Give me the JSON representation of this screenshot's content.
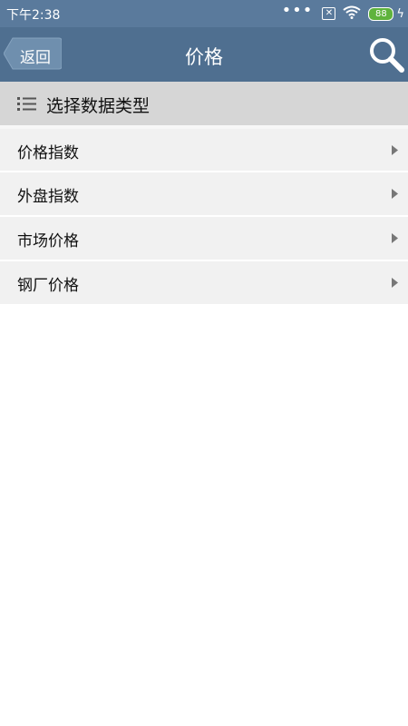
{
  "status": {
    "time": "下午2:38",
    "battery": "88"
  },
  "header": {
    "back_label": "返回",
    "title": "价格"
  },
  "section": {
    "title": "选择数据类型"
  },
  "items": [
    {
      "label": "价格指数"
    },
    {
      "label": "外盘指数"
    },
    {
      "label": "市场价格"
    },
    {
      "label": "钢厂价格"
    }
  ]
}
